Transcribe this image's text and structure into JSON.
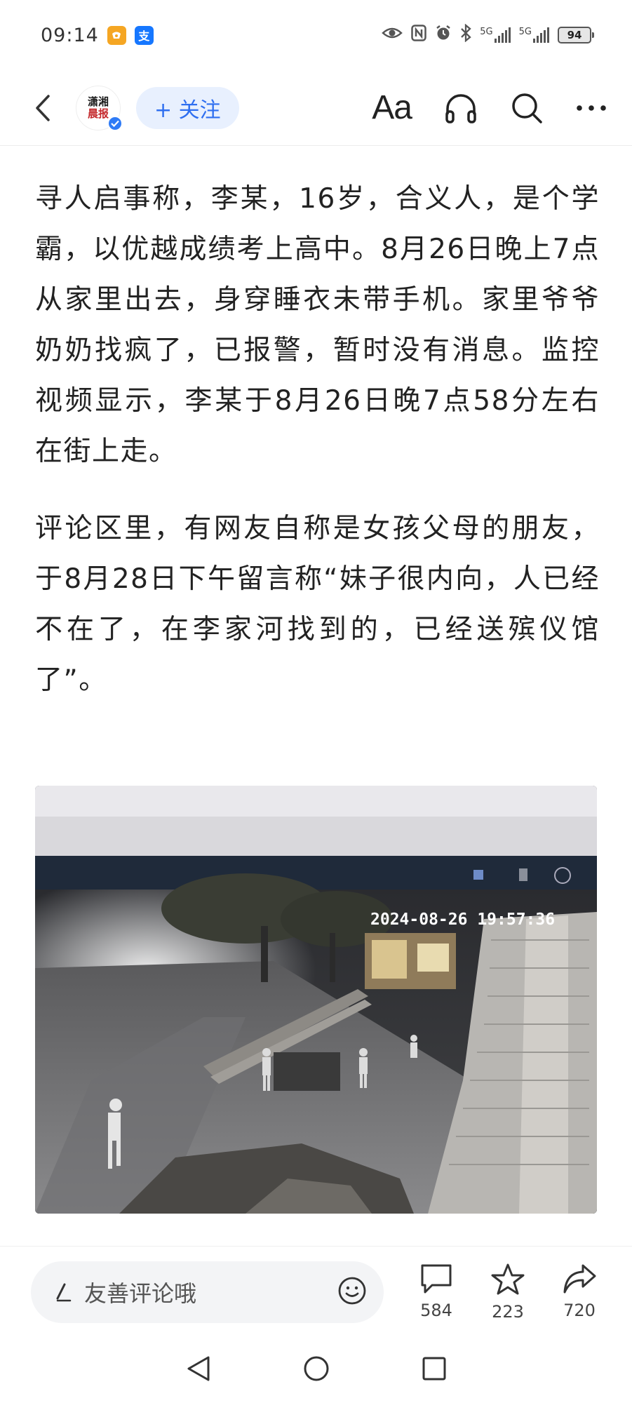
{
  "status_bar": {
    "time": "09:14",
    "app_icons": [
      "taobao-icon",
      "alipay-icon"
    ],
    "alipay_glyph": "支",
    "network_1": "5G",
    "network_2": "5G",
    "battery": "94"
  },
  "header": {
    "follow_label": "+ 关注",
    "font_label": "Aa",
    "logo_line1": "潇湘",
    "logo_line2": "晨报"
  },
  "article": {
    "paragraphs": [
      "寻人启事称，李某，16岁，合义人，是个学霸，以优越成绩考上高中。8月26日晚上7点从家里出去，身穿睡衣未带手机。家里爷爷奶奶找疯了，已报警，暂时没有消息。监控视频显示，李某于8月26日晚7点58分左右在街上走。",
      "评论区里，有网友自称是女孩父母的朋友，于8月28日下午留言称“妹子很内向，人已经不在了，在李家河找到的，已经送殡仪馆了”。"
    ],
    "image_timestamp": "2024-08-26 19:57:36"
  },
  "comment_bar": {
    "placeholder": "友善评论哦",
    "comments_count": "584",
    "favorites_count": "223",
    "shares_count": "720"
  },
  "colors": {
    "accent": "#2f6ff0",
    "follow_bg": "#e8f0fe",
    "verified": "#2f7bf6",
    "taobao": "#f5a623",
    "alipay": "#1677ff"
  }
}
